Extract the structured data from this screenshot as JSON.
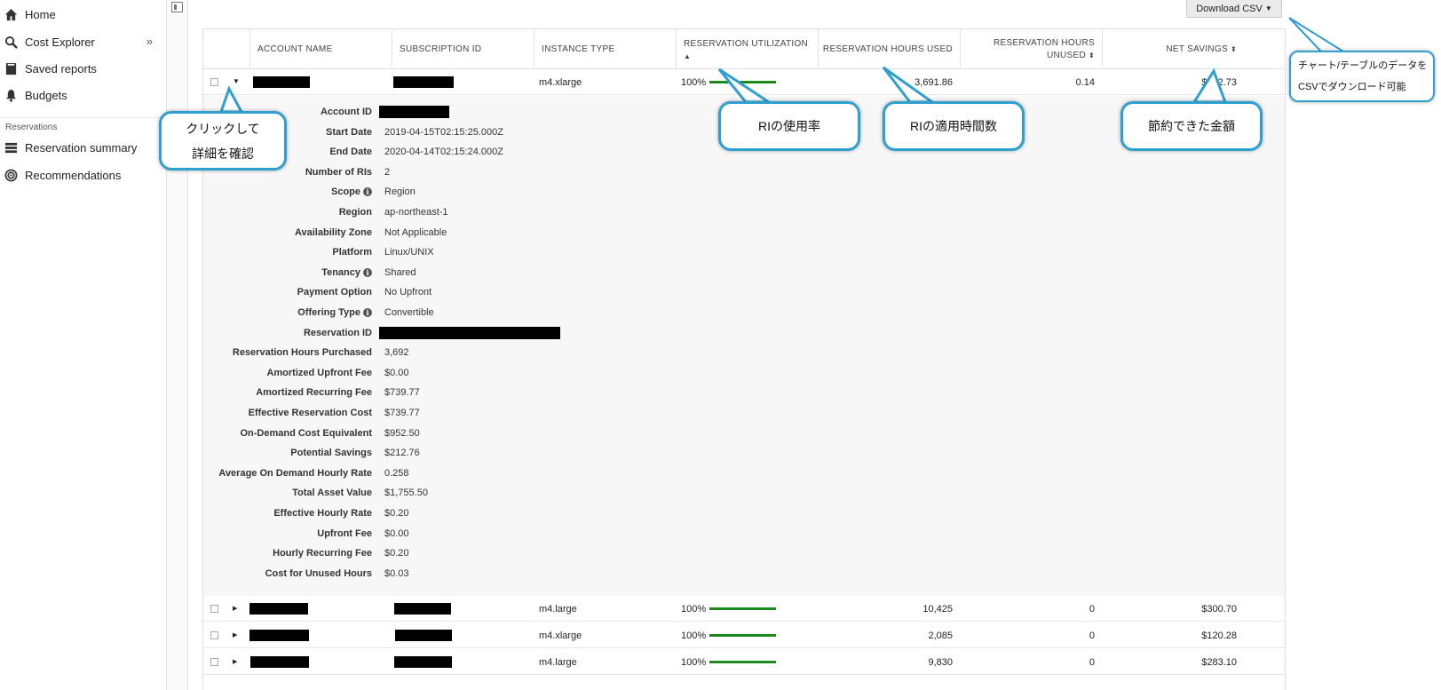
{
  "sidebar": {
    "items": [
      {
        "label": "Home",
        "icon": "home-icon"
      },
      {
        "label": "Cost Explorer",
        "icon": "search-icon"
      },
      {
        "label": "Saved reports",
        "icon": "report-icon"
      },
      {
        "label": "Budgets",
        "icon": "bell-icon"
      },
      {
        "label": "Reservation summary",
        "icon": "list-icon"
      },
      {
        "label": "Recommendations",
        "icon": "target-icon"
      }
    ],
    "chevron": "»",
    "section_label": "Reservations"
  },
  "toolbar": {
    "download_label": "Download CSV"
  },
  "table": {
    "headers": {
      "account_name": "ACCOUNT NAME",
      "subscription_id": "SUBSCRIPTION ID",
      "instance_type": "INSTANCE TYPE",
      "reservation_utilization": "RESERVATION UTILIZATION",
      "reservation_hours_used": "RESERVATION HOURS USED",
      "reservation_hours_unused_1": "RESERVATION HOURS",
      "reservation_hours_unused_2": "UNUSED",
      "net_savings": "NET SAVINGS"
    },
    "rows": [
      {
        "instance_type": "m4.xlarge",
        "utilization": "100%",
        "hours_used": "3,691.86",
        "hours_unused": "0.14",
        "net_savings": "$212.73"
      },
      {
        "instance_type": "m4.large",
        "utilization": "100%",
        "hours_used": "10,425",
        "hours_unused": "0",
        "net_savings": "$300.70"
      },
      {
        "instance_type": "m4.xlarge",
        "utilization": "100%",
        "hours_used": "2,085",
        "hours_unused": "0",
        "net_savings": "$120.28"
      },
      {
        "instance_type": "m4.large",
        "utilization": "100%",
        "hours_used": "9,830",
        "hours_unused": "0",
        "net_savings": "$283.10"
      }
    ]
  },
  "detail": {
    "fields": [
      {
        "label": "Account ID",
        "value": ""
      },
      {
        "label": "Start Date",
        "value": "2019-04-15T02:15:25.000Z"
      },
      {
        "label": "End Date",
        "value": "2020-04-14T02:15:24.000Z"
      },
      {
        "label": "Number of RIs",
        "value": "2"
      },
      {
        "label": "Scope",
        "value": "Region"
      },
      {
        "label": "Region",
        "value": "ap-northeast-1"
      },
      {
        "label": "Availability Zone",
        "value": "Not Applicable"
      },
      {
        "label": "Platform",
        "value": "Linux/UNIX"
      },
      {
        "label": "Tenancy",
        "value": "Shared"
      },
      {
        "label": "Payment Option",
        "value": "No Upfront"
      },
      {
        "label": "Offering Type",
        "value": "Convertible"
      },
      {
        "label": "Reservation ID",
        "value": ""
      },
      {
        "label": "Reservation Hours Purchased",
        "value": "3,692"
      },
      {
        "label": "Amortized Upfront Fee",
        "value": "$0.00"
      },
      {
        "label": "Amortized Recurring Fee",
        "value": "$739.77"
      },
      {
        "label": "Effective Reservation Cost",
        "value": "$739.77"
      },
      {
        "label": "On-Demand Cost Equivalent",
        "value": "$952.50"
      },
      {
        "label": "Potential Savings",
        "value": "$212.76"
      },
      {
        "label": "Average On Demand Hourly Rate",
        "value": "0.258"
      },
      {
        "label": "Total Asset Value",
        "value": "$1,755.50"
      },
      {
        "label": "Effective Hourly Rate",
        "value": "$0.20"
      },
      {
        "label": "Upfront Fee",
        "value": "$0.00"
      },
      {
        "label": "Hourly Recurring Fee",
        "value": "$0.20"
      },
      {
        "label": "Cost for Unused Hours",
        "value": "$0.03"
      }
    ]
  },
  "callouts": {
    "click": {
      "line1": "クリックして",
      "line2": "詳細を確認"
    },
    "utilization": "RIの使用率",
    "hours": "RIの適用時間数",
    "savings": "節約できた金額",
    "csv": {
      "line1": "チャート/テーブルのデータを",
      "line2": "CSVでダウンロード可能"
    }
  },
  "colors": {
    "callout_border": "#2f9fd0",
    "util_bar": "#1d8a1d"
  }
}
